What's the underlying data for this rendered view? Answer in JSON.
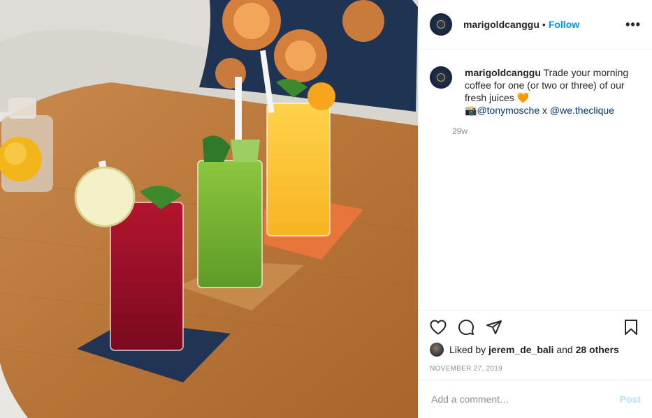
{
  "photo": {
    "description_icon": "juice-glasses-photo"
  },
  "header": {
    "username": "marigoldcanggu",
    "separator": "•",
    "follow_label": "Follow",
    "more_icon": "more-options-icon"
  },
  "caption": {
    "username": "marigoldcanggu",
    "text": "Trade your morning coffee for one (or two or three) of our fresh juices 🧡",
    "camera_emoji": "📸",
    "mention_1": "@tonymosche",
    "joiner": " x ",
    "mention_2": "@we.theclique",
    "time": "29w"
  },
  "actions": {
    "like_icon": "heart-icon",
    "comment_icon": "comment-icon",
    "share_icon": "share-icon",
    "save_icon": "bookmark-icon"
  },
  "likes": {
    "prefix": "Liked by",
    "user": "jerem_de_bali",
    "and": "and",
    "others": "28 others"
  },
  "date": "NOVEMBER 27, 2019",
  "comment": {
    "placeholder": "Add a comment…",
    "post_label": "Post"
  },
  "colors": {
    "accent": "#0095f6",
    "post_disabled": "#b2dffc",
    "mention": "#00376b",
    "muted": "#8e8e8e"
  }
}
